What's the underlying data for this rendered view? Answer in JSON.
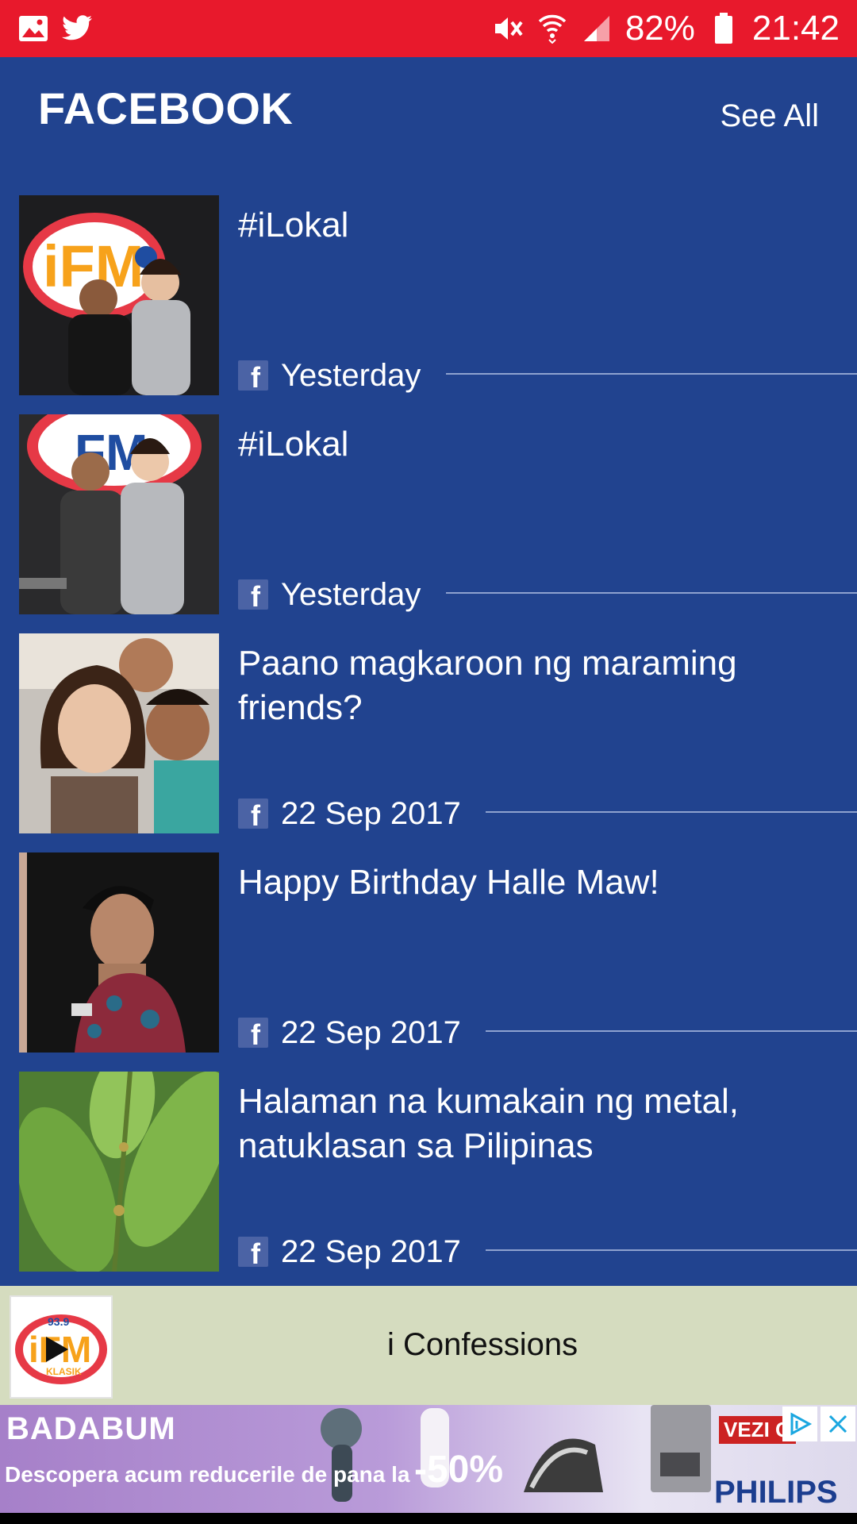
{
  "status_bar": {
    "battery": "82%",
    "time": "21:42",
    "icons": [
      "image-icon",
      "twitter-icon",
      "mute-icon",
      "wifi-icon",
      "signal-icon",
      "battery-icon"
    ]
  },
  "header": {
    "title": "FACEBOOK",
    "see_all": "See All"
  },
  "feed": [
    {
      "title": "#iLokal",
      "date": "Yesterday",
      "source_icon": "facebook-icon"
    },
    {
      "title": "#iLokal",
      "date": "Yesterday",
      "source_icon": "facebook-icon"
    },
    {
      "title": "Paano magkaroon ng maraming friends?",
      "date": "22 Sep 2017",
      "source_icon": "facebook-icon"
    },
    {
      "title": "Happy Birthday Halle Maw!",
      "date": "22 Sep 2017",
      "source_icon": "facebook-icon"
    },
    {
      "title": "Halaman na kumakain ng metal, natuklasan sa Pilipinas",
      "date": "22 Sep 2017",
      "source_icon": "facebook-icon"
    }
  ],
  "player": {
    "title": "i Confessions",
    "logo_text": "93.9",
    "logo_word": "iFM",
    "logo_sub": "KLASIK"
  },
  "ad": {
    "brand": "BADABUM",
    "tagline": "Descopera acum reducerile de pana la",
    "discount": "-50%",
    "cta": "VEZI O",
    "sponsor": "PHILIPS"
  },
  "colors": {
    "status_bar": "#e8192c",
    "background": "#21438f",
    "player_bg": "#d5dcbf",
    "divider": "#8ea2cf"
  }
}
